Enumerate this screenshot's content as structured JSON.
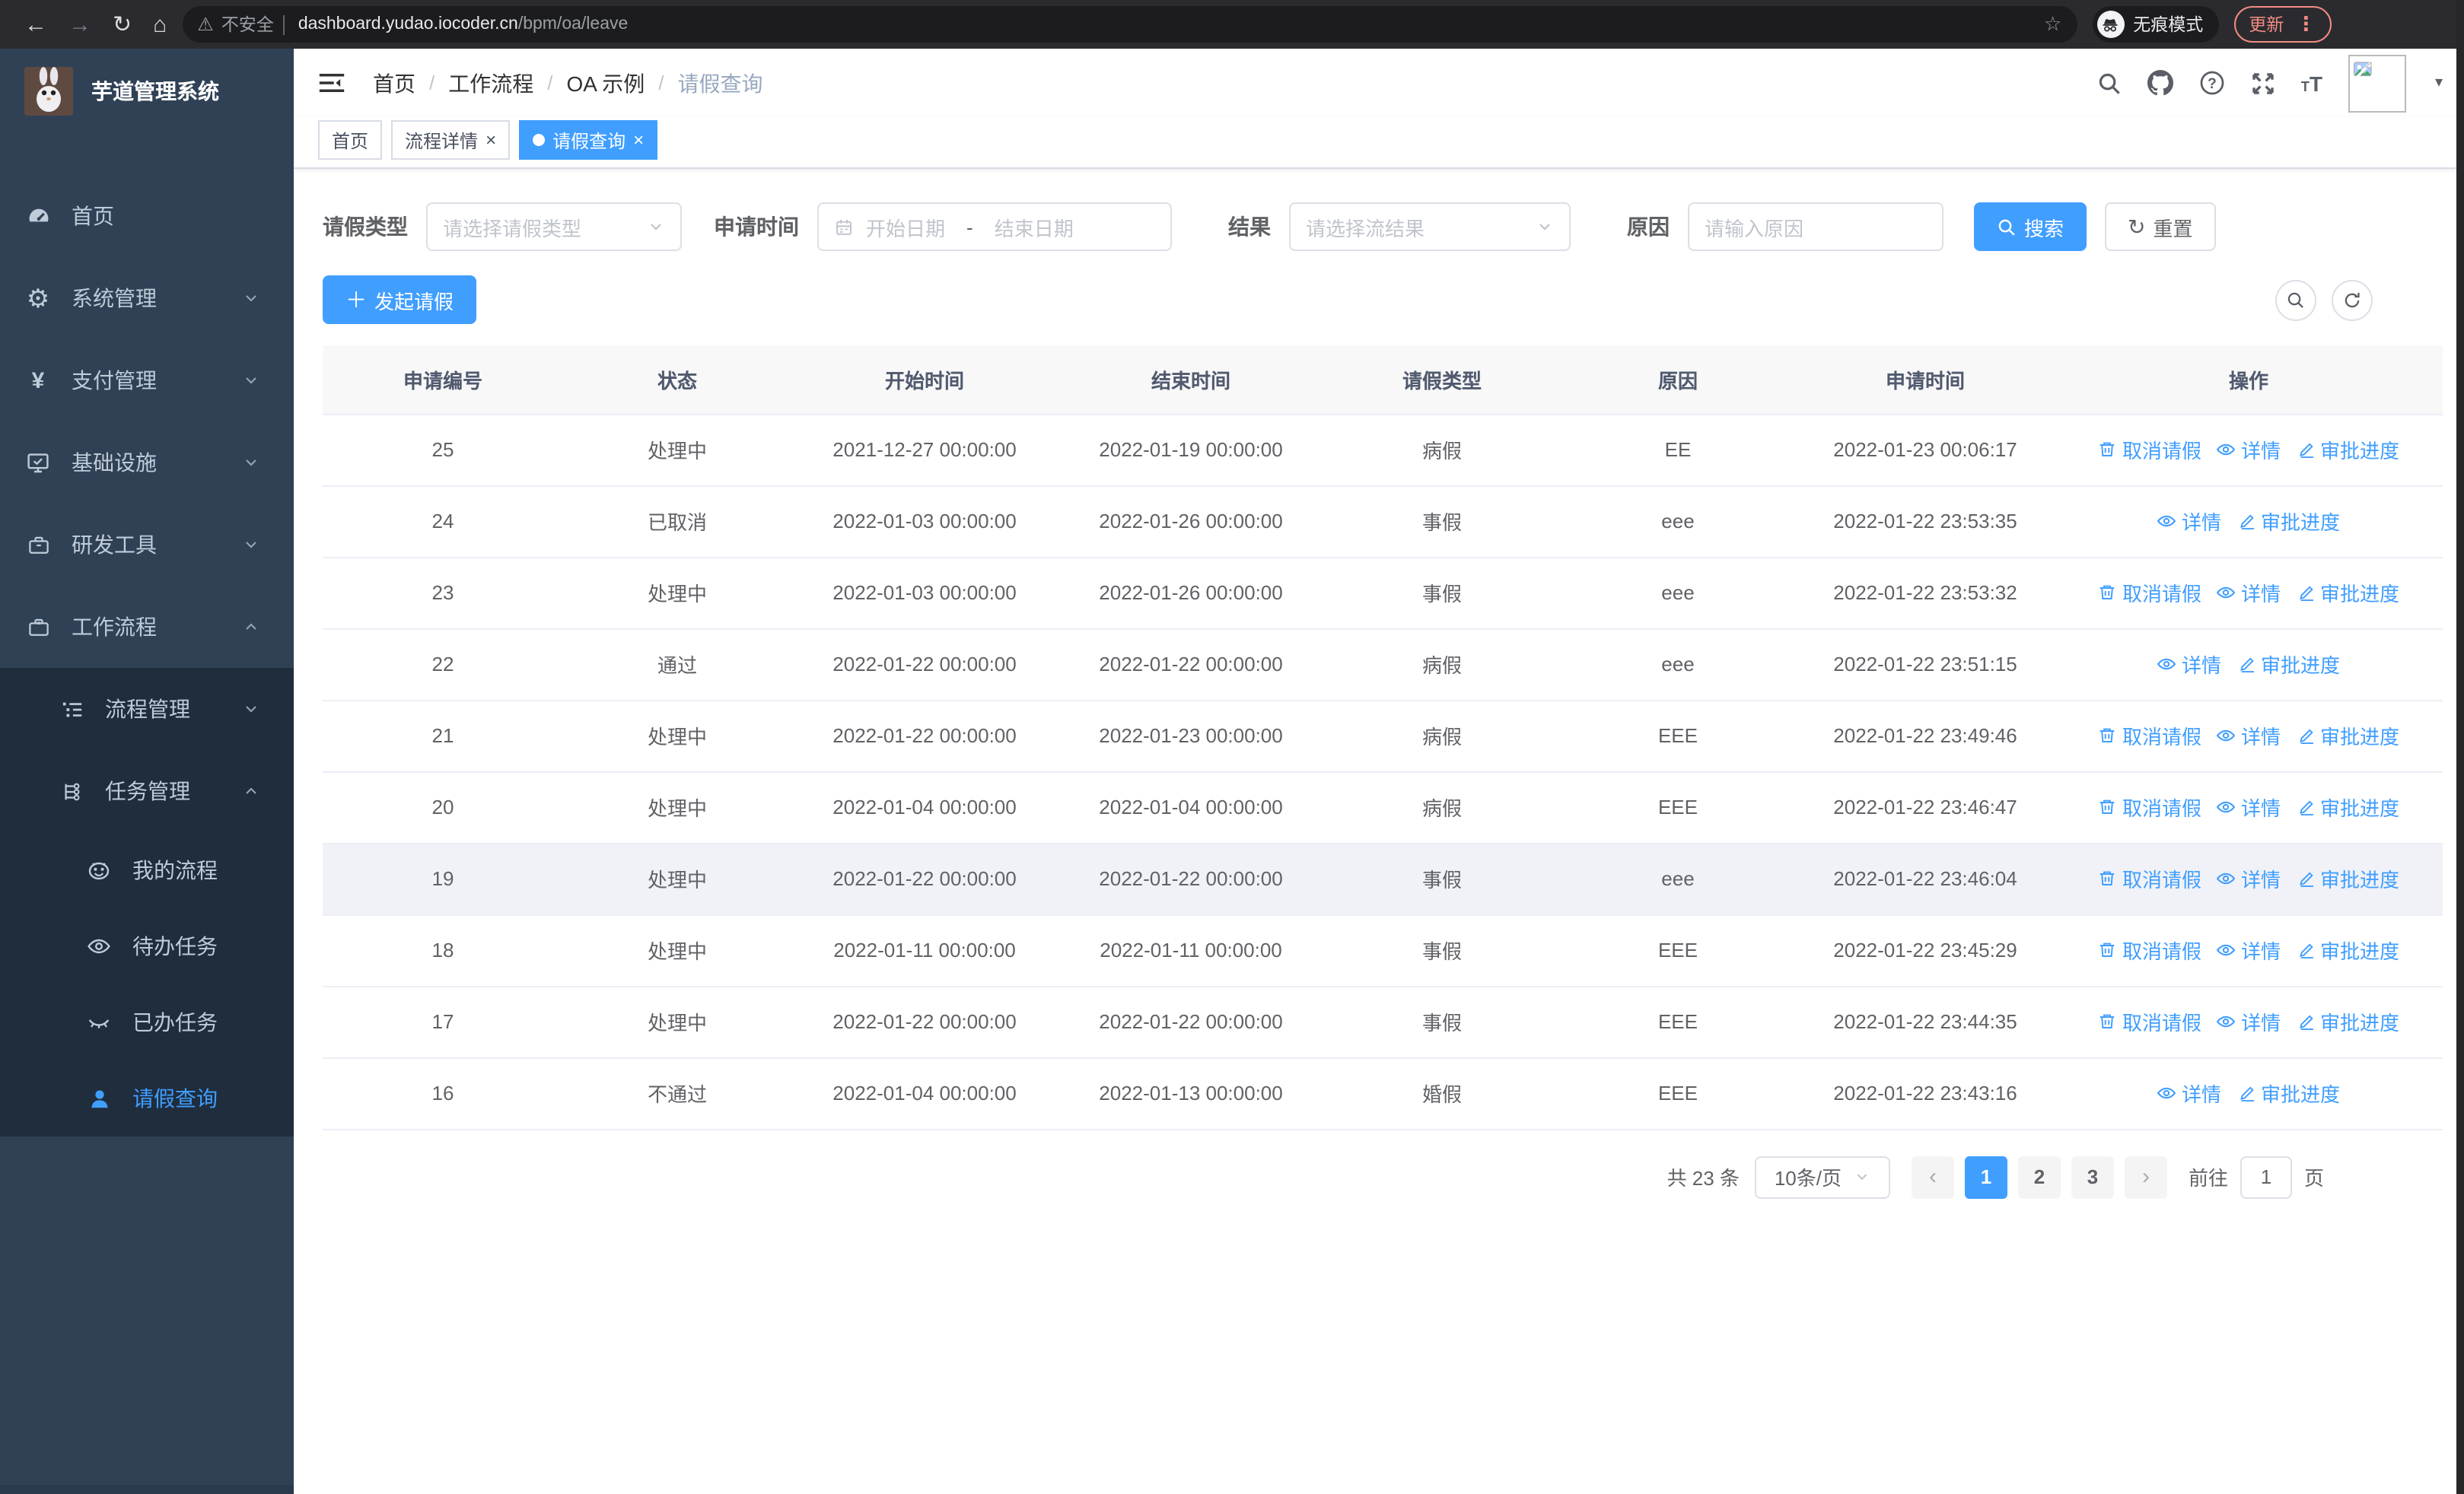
{
  "colors": {
    "accent": "#409eff",
    "sidebar_bg": "#304156",
    "submenu_bg": "#1f2d3d",
    "chrome_salmon": "#f28b82"
  },
  "browser": {
    "security_label": "不安全",
    "url_host": "dashboard.yudao.iocoder.cn",
    "url_path": "/bpm/oa/leave",
    "incognito_label": "无痕模式",
    "update_label": "更新"
  },
  "app": {
    "title": "芋道管理系统"
  },
  "sidebar": {
    "items": [
      {
        "name": "home",
        "label": "首页",
        "icon": "dashboard-icon",
        "level": 1,
        "arrow": ""
      },
      {
        "name": "system-mgmt",
        "label": "系统管理",
        "icon": "gear-icon",
        "level": 1,
        "arrow": "down"
      },
      {
        "name": "payment-mgmt",
        "label": "支付管理",
        "icon": "yen-icon",
        "level": 1,
        "arrow": "down"
      },
      {
        "name": "infrastructure",
        "label": "基础设施",
        "icon": "monitor-icon",
        "level": 1,
        "arrow": "down"
      },
      {
        "name": "dev-tools",
        "label": "研发工具",
        "icon": "toolbox-icon",
        "level": 1,
        "arrow": "down"
      },
      {
        "name": "workflow",
        "label": "工作流程",
        "icon": "briefcase-icon",
        "level": 1,
        "arrow": "up"
      },
      {
        "name": "process-mgmt",
        "label": "流程管理",
        "icon": "list-tree-icon",
        "level": 2,
        "arrow": "down"
      },
      {
        "name": "task-mgmt",
        "label": "任务管理",
        "icon": "nodes-icon",
        "level": 2,
        "arrow": "up"
      },
      {
        "name": "my-process",
        "label": "我的流程",
        "icon": "robot-icon",
        "level": 3,
        "arrow": ""
      },
      {
        "name": "todo-tasks",
        "label": "待办任务",
        "icon": "eye-icon",
        "level": 3,
        "arrow": ""
      },
      {
        "name": "done-tasks",
        "label": "已办任务",
        "icon": "eye-closed-icon",
        "level": 3,
        "arrow": ""
      },
      {
        "name": "leave-query",
        "label": "请假查询",
        "icon": "user-icon",
        "level": 3,
        "arrow": "",
        "active": true
      }
    ]
  },
  "breadcrumb": {
    "items": [
      "首页",
      "工作流程",
      "OA 示例",
      "请假查询"
    ]
  },
  "tabs": [
    {
      "label": "首页",
      "closable": false,
      "active": false
    },
    {
      "label": "流程详情",
      "closable": true,
      "active": false
    },
    {
      "label": "请假查询",
      "closable": true,
      "active": true
    }
  ],
  "filters": {
    "leave_type_label": "请假类型",
    "leave_type_placeholder": "请选择请假类型",
    "time_label": "申请时间",
    "start_placeholder": "开始日期",
    "range_separator": "-",
    "end_placeholder": "结束日期",
    "result_label": "结果",
    "result_placeholder": "请选择流结果",
    "reason_label": "原因",
    "reason_placeholder": "请输入原因",
    "search_label": "搜索",
    "reset_label": "重置"
  },
  "toolbar": {
    "create_label": "发起请假"
  },
  "table": {
    "headers": [
      "申请编号",
      "状态",
      "开始时间",
      "结束时间",
      "请假类型",
      "原因",
      "申请时间",
      "操作"
    ],
    "action_labels": {
      "cancel": "取消请假",
      "detail": "详情",
      "progress": "审批进度"
    },
    "rows": [
      {
        "id": "25",
        "status": "处理中",
        "start": "2021-12-27 00:00:00",
        "end": "2022-01-19 00:00:00",
        "type": "病假",
        "reason": "EE",
        "applied": "2022-01-23 00:06:17",
        "actions": [
          "cancel",
          "detail",
          "progress"
        ]
      },
      {
        "id": "24",
        "status": "已取消",
        "start": "2022-01-03 00:00:00",
        "end": "2022-01-26 00:00:00",
        "type": "事假",
        "reason": "eee",
        "applied": "2022-01-22 23:53:35",
        "actions": [
          "detail",
          "progress"
        ]
      },
      {
        "id": "23",
        "status": "处理中",
        "start": "2022-01-03 00:00:00",
        "end": "2022-01-26 00:00:00",
        "type": "事假",
        "reason": "eee",
        "applied": "2022-01-22 23:53:32",
        "actions": [
          "cancel",
          "detail",
          "progress"
        ]
      },
      {
        "id": "22",
        "status": "通过",
        "start": "2022-01-22 00:00:00",
        "end": "2022-01-22 00:00:00",
        "type": "病假",
        "reason": "eee",
        "applied": "2022-01-22 23:51:15",
        "actions": [
          "detail",
          "progress"
        ]
      },
      {
        "id": "21",
        "status": "处理中",
        "start": "2022-01-22 00:00:00",
        "end": "2022-01-23 00:00:00",
        "type": "病假",
        "reason": "EEE",
        "applied": "2022-01-22 23:49:46",
        "actions": [
          "cancel",
          "detail",
          "progress"
        ]
      },
      {
        "id": "20",
        "status": "处理中",
        "start": "2022-01-04 00:00:00",
        "end": "2022-01-04 00:00:00",
        "type": "病假",
        "reason": "EEE",
        "applied": "2022-01-22 23:46:47",
        "actions": [
          "cancel",
          "detail",
          "progress"
        ]
      },
      {
        "id": "19",
        "status": "处理中",
        "start": "2022-01-22 00:00:00",
        "end": "2022-01-22 00:00:00",
        "type": "事假",
        "reason": "eee",
        "applied": "2022-01-22 23:46:04",
        "actions": [
          "cancel",
          "detail",
          "progress"
        ],
        "highlight": true
      },
      {
        "id": "18",
        "status": "处理中",
        "start": "2022-01-11 00:00:00",
        "end": "2022-01-11 00:00:00",
        "type": "事假",
        "reason": "EEE",
        "applied": "2022-01-22 23:45:29",
        "actions": [
          "cancel",
          "detail",
          "progress"
        ]
      },
      {
        "id": "17",
        "status": "处理中",
        "start": "2022-01-22 00:00:00",
        "end": "2022-01-22 00:00:00",
        "type": "事假",
        "reason": "EEE",
        "applied": "2022-01-22 23:44:35",
        "actions": [
          "cancel",
          "detail",
          "progress"
        ]
      },
      {
        "id": "16",
        "status": "不通过",
        "start": "2022-01-04 00:00:00",
        "end": "2022-01-13 00:00:00",
        "type": "婚假",
        "reason": "EEE",
        "applied": "2022-01-22 23:43:16",
        "actions": [
          "detail",
          "progress"
        ]
      }
    ]
  },
  "pagination": {
    "total_label": "共 23 条",
    "page_size_label": "10条/页",
    "pages": [
      "1",
      "2",
      "3"
    ],
    "active_page": "1",
    "goto_label": "前往",
    "goto_value": "1",
    "goto_suffix": "页"
  }
}
